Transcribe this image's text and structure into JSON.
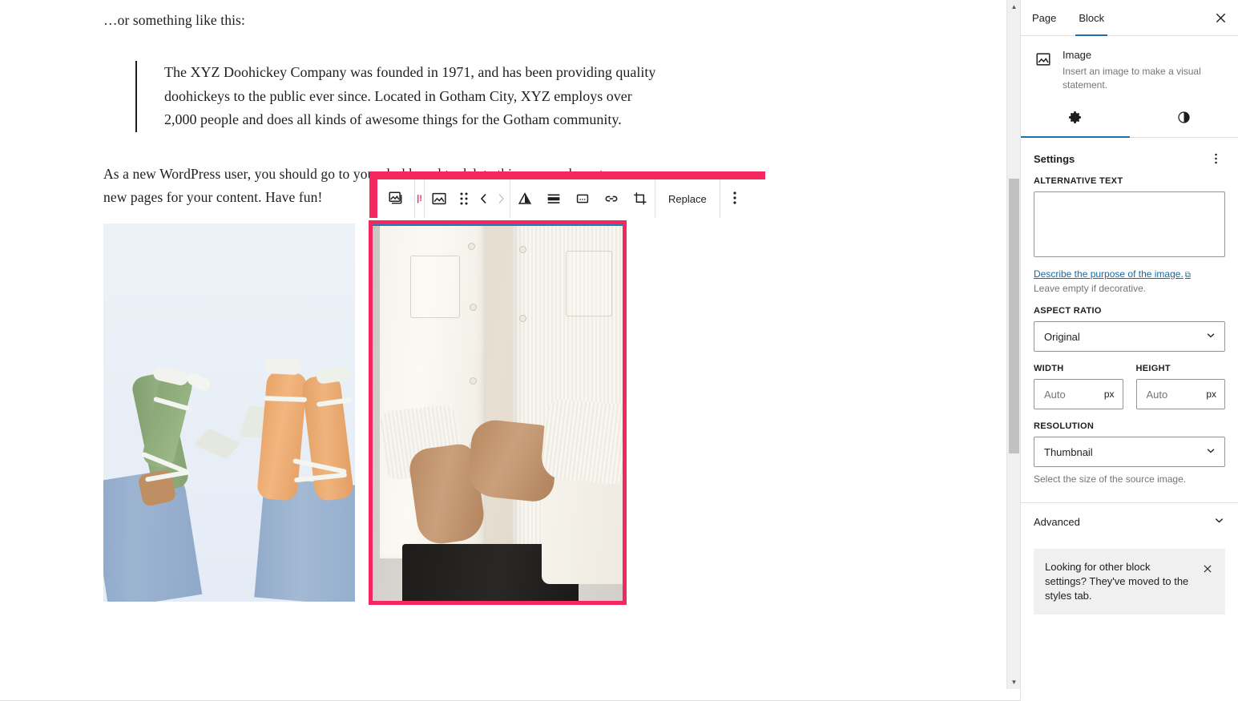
{
  "editor": {
    "intro_paragraph": "…or something like this:",
    "quote": "The XYZ Doohickey Company was founded in 1971, and has been providing quality doohickeys to the public ever since. Located in Gotham City, XYZ employs over 2,000 people and does all kinds of awesome things for the Gotham community.",
    "body_paragraph": "As a new WordPress user, you should go to your dashboard to delete this page and create new pages for your content. Have fun!"
  },
  "toolbar": {
    "parent_block_icon": "image-stack-icon",
    "block_type_icon": "image-icon",
    "drag_icon": "drag-handle-icon",
    "move_up_icon": "chevron-left-icon",
    "move_down_icon": "chevron-right-icon",
    "align_icon": "align-icon",
    "text_align_icon": "text-align-icon",
    "caption_icon": "caption-icon",
    "link_icon": "link-icon",
    "crop_icon": "crop-icon",
    "replace_label": "Replace",
    "more_options_icon": "more-options-icon",
    "highlight_color": "#f4285e"
  },
  "sidebar": {
    "tabs": [
      {
        "label": "Page",
        "active": false
      },
      {
        "label": "Block",
        "active": true
      }
    ],
    "close_icon": "close-icon",
    "block_card": {
      "icon": "image-icon",
      "title": "Image",
      "description": "Insert an image to make a visual statement."
    },
    "inner_tabs": [
      {
        "icon": "gear-icon",
        "name": "settings",
        "active": true
      },
      {
        "icon": "contrast-icon",
        "name": "styles",
        "active": false
      }
    ],
    "settings": {
      "title": "Settings",
      "menu_icon": "more-options-icon",
      "alternative_text": {
        "label": "ALTERNATIVE TEXT",
        "value": "",
        "help_link": "Describe the purpose of the image.",
        "external_icon": "external-link-icon",
        "note": "Leave empty if decorative."
      },
      "aspect_ratio": {
        "label": "ASPECT RATIO",
        "value": "Original",
        "chevron_icon": "chevron-down-icon"
      },
      "width": {
        "label": "WIDTH",
        "value": "",
        "placeholder": "Auto",
        "unit": "px"
      },
      "height": {
        "label": "HEIGHT",
        "value": "",
        "placeholder": "Auto",
        "unit": "px"
      },
      "resolution": {
        "label": "RESOLUTION",
        "value": "Thumbnail",
        "chevron_icon": "chevron-down-icon",
        "help": "Select the size of the source image."
      }
    },
    "advanced": {
      "label": "Advanced",
      "chevron_icon": "chevron-down-icon"
    },
    "notice": {
      "text": "Looking for other block settings? They've moved to the styles tab.",
      "close_icon": "close-icon"
    }
  },
  "colors": {
    "accent_blue": "#1e6ea8",
    "highlight_pink": "#f4285e",
    "selection_blue": "#1f7cc0",
    "text": "#1e1e1e",
    "muted": "#757575",
    "border": "#e0e0e0"
  },
  "scrollbar": {
    "up_arrow_icon": "caret-up-icon",
    "down_arrow_icon": "caret-down-icon"
  }
}
